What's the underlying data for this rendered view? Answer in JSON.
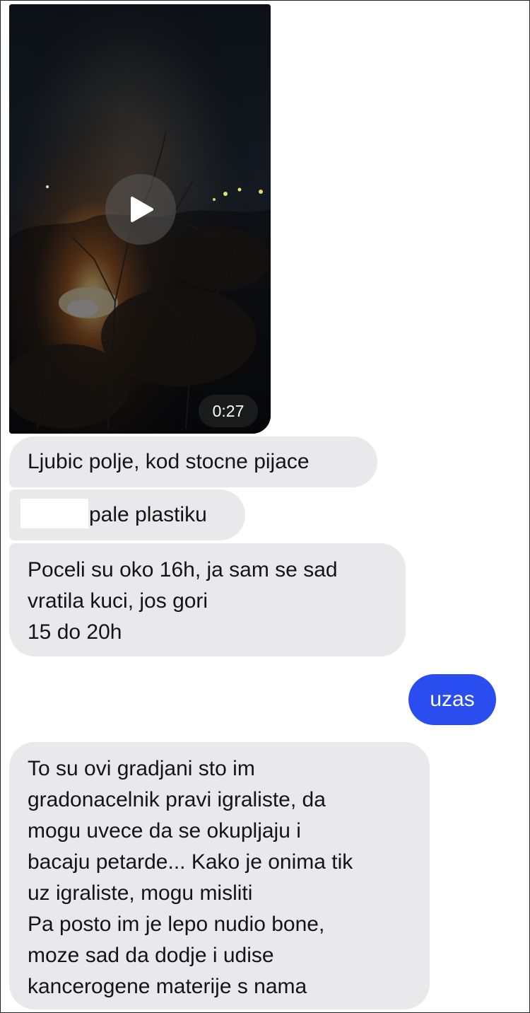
{
  "video": {
    "duration": "0:27",
    "icons": {
      "play": "play-icon"
    }
  },
  "messages": [
    {
      "sender": "other",
      "text": "Ljubic polje, kod stocne pijace"
    },
    {
      "sender": "other",
      "text": "pale plastiku"
    },
    {
      "sender": "other",
      "text": "Poceli su oko 16h, ja sam se sad\nvratila kuci, jos gori\n15 do 20h"
    },
    {
      "sender": "me",
      "text": "uzas"
    },
    {
      "sender": "other",
      "text": "To su ovi gradjani sto im\ngradonacelnik pravi igraliste, da\nmogu uvece da se okupljaju i\nbacaju petarde... Kako je onima tik\nuz igraliste, mogu misliti\nPa posto im je lepo nudio bone,\nmoze sad da dodje i udise\nkancerogene materije s nama"
    }
  ],
  "colors": {
    "incoming_bubble": "#e9e9eb",
    "outgoing_bubble": "#2a4df0",
    "incoming_text": "#141414",
    "outgoing_text": "#ffffff"
  }
}
